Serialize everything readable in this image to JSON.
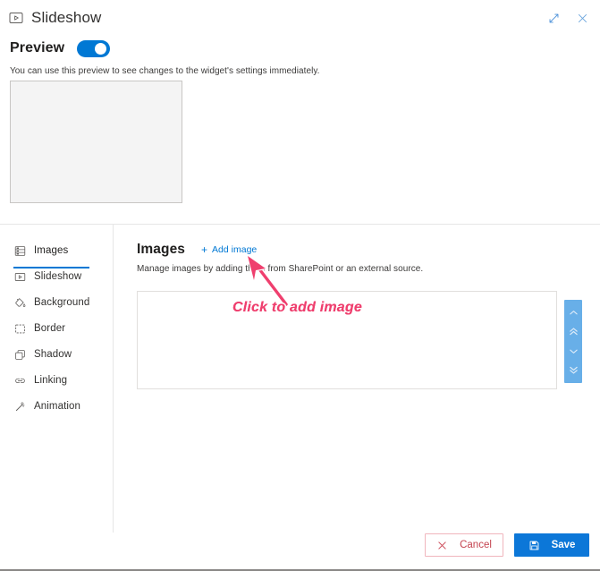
{
  "window": {
    "title": "Slideshow",
    "title_icon": "slideshow-icon",
    "expand_icon": "expand-diagonal-icon",
    "close_icon": "close-icon"
  },
  "preview": {
    "label": "Preview",
    "toggle_state": "on",
    "description": "You can use this preview to see changes to the widget's settings immediately.",
    "box_placeholder": ""
  },
  "sidebar": {
    "active_index": 0,
    "items": [
      {
        "label": "Images",
        "icon": "images-stack-icon"
      },
      {
        "label": "Slideshow",
        "icon": "slideshow-icon"
      },
      {
        "label": "Background",
        "icon": "paint-bucket-icon"
      },
      {
        "label": "Border",
        "icon": "border-square-icon"
      },
      {
        "label": "Shadow",
        "icon": "shadow-squares-icon"
      },
      {
        "label": "Linking",
        "icon": "link-chain-icon"
      },
      {
        "label": "Animation",
        "icon": "magic-wand-icon"
      }
    ]
  },
  "main": {
    "title": "Images",
    "add_link": "Add image",
    "add_link_icon": "plus-icon",
    "description": "Manage images by adding them from SharePoint or an external source.",
    "list_empty_text": ""
  },
  "reorder_rail": {
    "buttons": [
      {
        "name": "move-up",
        "icon": "chevron-up-icon"
      },
      {
        "name": "move-top",
        "icon": "double-chevron-up-icon"
      },
      {
        "name": "move-down",
        "icon": "chevron-down-icon"
      },
      {
        "name": "move-bottom",
        "icon": "double-chevron-down-icon"
      }
    ]
  },
  "annotation": {
    "text": "Click to add image",
    "arrow_icon": "arrow-pointer-icon"
  },
  "footer": {
    "cancel_label": "Cancel",
    "cancel_icon": "close-icon",
    "save_label": "Save",
    "save_icon": "floppy-disk-icon"
  },
  "colors": {
    "accent_blue": "#0078d4",
    "save_blue": "#0c77d8",
    "rail_blue": "#68afe8",
    "annotation_pink": "#ef3f6e",
    "cancel_red": "#c4434f",
    "cancel_border": "#f0b5bd",
    "text_primary": "#201f1e",
    "text_secondary": "#3b3a39",
    "divider": "#e6e6e6",
    "preview_box_bg": "#f4f4f4"
  }
}
